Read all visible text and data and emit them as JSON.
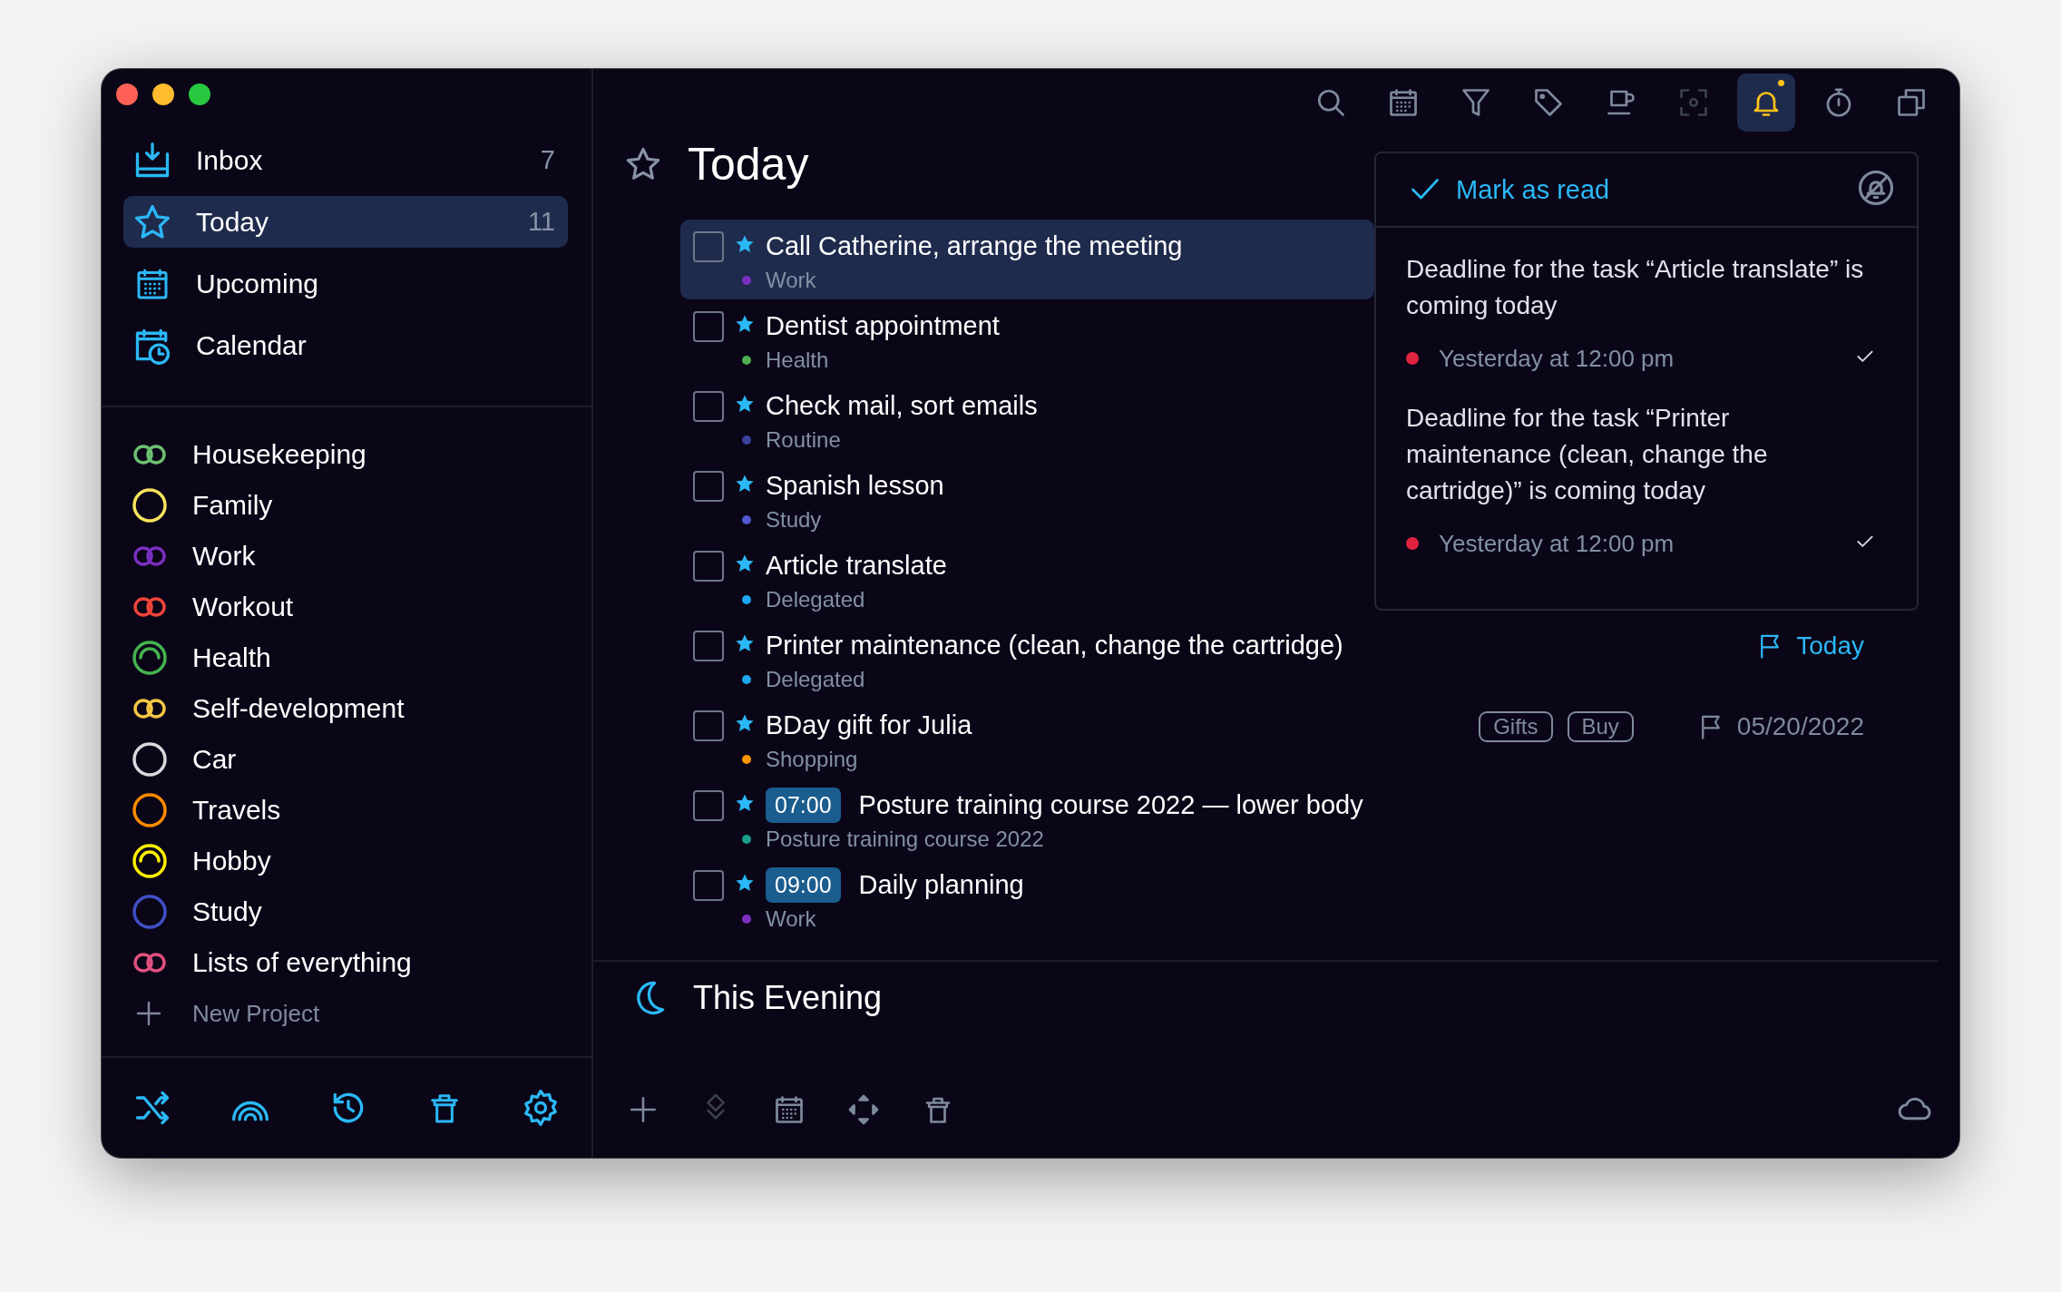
{
  "sidebar": {
    "nav": [
      {
        "kind": "inbox",
        "label": "Inbox",
        "count": "7",
        "selected": false
      },
      {
        "kind": "today",
        "label": "Today",
        "count": "11",
        "selected": true
      },
      {
        "kind": "upcoming",
        "label": "Upcoming",
        "selected": false
      },
      {
        "kind": "calendar",
        "label": "Calendar",
        "selected": false
      }
    ],
    "projects": [
      {
        "kind": "shared",
        "name": "Housekeeping",
        "color": "#6cc070"
      },
      {
        "kind": "circle",
        "name": "Family",
        "color": "#f7e35c"
      },
      {
        "kind": "shared",
        "name": "Work",
        "color": "#7a2fc0"
      },
      {
        "kind": "shared",
        "name": "Workout",
        "color": "#f0453a"
      },
      {
        "kind": "progress",
        "name": "Health",
        "color": "#45b34f"
      },
      {
        "kind": "shared",
        "name": "Self-development",
        "color": "#f6c744"
      },
      {
        "kind": "circle",
        "name": "Car",
        "color": "#d9d9dd"
      },
      {
        "kind": "circle",
        "name": "Travels",
        "color": "#ff8a00"
      },
      {
        "kind": "progress",
        "name": "Hobby",
        "color": "#fff000"
      },
      {
        "kind": "circle",
        "name": "Study",
        "color": "#3f4fc6"
      },
      {
        "kind": "shared",
        "name": "Lists of everything",
        "color": "#e2517e"
      }
    ],
    "new_project": "New Project"
  },
  "toolbar": [
    {
      "kind": "search",
      "selected": false,
      "disabled": false,
      "badge": false
    },
    {
      "kind": "calendar",
      "selected": false,
      "disabled": false,
      "badge": false
    },
    {
      "kind": "filter",
      "selected": false,
      "disabled": false,
      "badge": false
    },
    {
      "kind": "tag",
      "selected": false,
      "disabled": false,
      "badge": false
    },
    {
      "kind": "cup",
      "selected": false,
      "disabled": false,
      "badge": false
    },
    {
      "kind": "focus",
      "selected": false,
      "disabled": true,
      "badge": false
    },
    {
      "kind": "bell",
      "selected": true,
      "disabled": false,
      "badge": true
    },
    {
      "kind": "timer",
      "selected": false,
      "disabled": false,
      "badge": false
    },
    {
      "kind": "windows",
      "selected": false,
      "disabled": false,
      "badge": false
    }
  ],
  "header": {
    "title": "Today"
  },
  "tasks": [
    {
      "title": "Call Catherine, arrange the meeting",
      "project": "Work",
      "color": "#7a2fc0",
      "selected": true,
      "checked": false,
      "starred": true
    },
    {
      "title": "Dentist appointment",
      "project": "Health",
      "color": "#4caf50",
      "selected": false,
      "checked": false,
      "starred": true
    },
    {
      "title": "Check mail, sort emails",
      "project": "Routine",
      "color": "#3b3f9e",
      "selected": false,
      "checked": false,
      "starred": true
    },
    {
      "title": "Spanish lesson",
      "project": "Study",
      "color": "#5058d0",
      "selected": false,
      "checked": false,
      "starred": true
    },
    {
      "title": "Article translate",
      "project": "Delegated",
      "color": "#1fa8f0",
      "selected": false,
      "checked": false,
      "starred": true
    },
    {
      "title": "Printer maintenance (clean, change the cartridge)",
      "project": "Delegated",
      "color": "#1fa8f0",
      "selected": false,
      "checked": false,
      "starred": true,
      "due": {
        "label": "Today",
        "highlight": true
      }
    },
    {
      "title": "BDay gift for Julia",
      "project": "Shopping",
      "color": "#ff9500",
      "selected": false,
      "checked": false,
      "starred": true,
      "tags": [
        "Gifts",
        "Buy"
      ],
      "due": {
        "label": "05/20/2022",
        "highlight": false
      }
    },
    {
      "title": "Posture training course 2022 — lower body",
      "project": "Posture training course 2022",
      "color": "#1a9e8a",
      "selected": false,
      "checked": false,
      "starred": true,
      "time": "07:00"
    },
    {
      "title": "Daily planning",
      "project": "Work",
      "color": "#7a2fc0",
      "selected": false,
      "checked": false,
      "starred": true,
      "time": "09:00"
    }
  ],
  "section": {
    "title": "This Evening"
  },
  "notifications": {
    "mark_read": "Mark as read",
    "items": [
      {
        "text": "Deadline for the task “Article translate” is coming today",
        "time": "Yesterday at 12:00 pm",
        "color": "#e0233f"
      },
      {
        "text": "Deadline for the task “Printer maintenance (clean, change the cartridge)” is coming today",
        "time": "Yesterday at 12:00 pm",
        "color": "#e0233f"
      }
    ]
  }
}
